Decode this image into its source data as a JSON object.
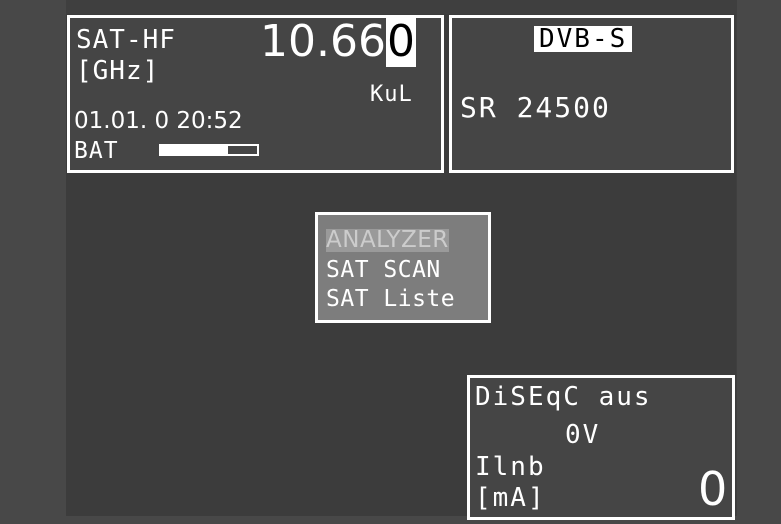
{
  "freq_panel": {
    "label": "SAT-HF",
    "unit": "[GHz]",
    "frequency_main": "10.66",
    "frequency_cursor_digit": "0",
    "band": "KuL",
    "datetime": "01.01. 0 20:52",
    "battery_label": "BAT",
    "battery_level": 0.7
  },
  "mode_panel": {
    "standard": "DVB-S",
    "symbol_rate": "SR 24500"
  },
  "menu": {
    "items": [
      "ANALYZER",
      "SAT SCAN",
      "SAT Liste"
    ],
    "selected_index": 0
  },
  "diseqc_panel": {
    "diseqc": "DiSEqC aus",
    "voltage": "0V",
    "ilnb_label": "Ilnb",
    "ilnb_unit": "[mA]",
    "ilnb_value": "0"
  }
}
